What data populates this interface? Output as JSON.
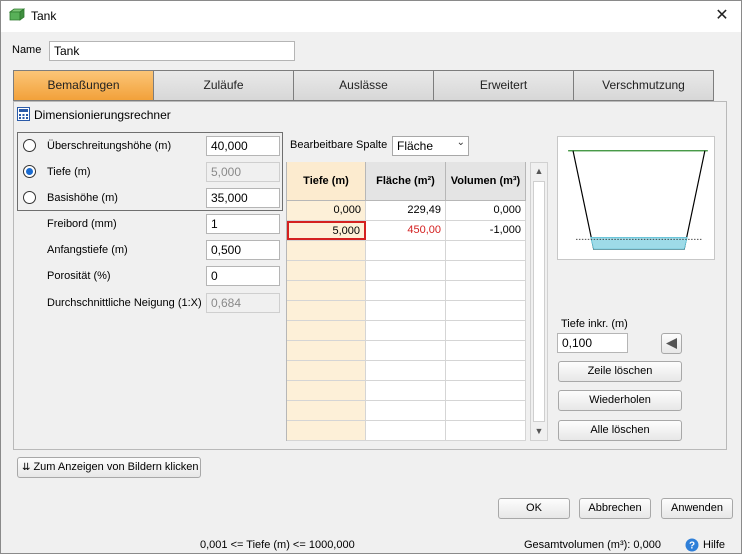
{
  "window": {
    "title": "Tank",
    "close_symbol": "✕"
  },
  "name_field": {
    "label": "Name",
    "value": "Tank"
  },
  "tabs": [
    {
      "label": "Bemaßungen",
      "active": true
    },
    {
      "label": "Zuläufe",
      "active": false
    },
    {
      "label": "Auslässe",
      "active": false
    },
    {
      "label": "Erweitert",
      "active": false
    },
    {
      "label": "Verschmutzung",
      "active": false
    }
  ],
  "calculator": {
    "label": "Dimensionierungsrechner"
  },
  "radio_group": [
    {
      "label": "Überschreitungshöhe (m)",
      "value": "40,000",
      "selected": false,
      "disabled": false
    },
    {
      "label": "Tiefe (m)",
      "value": "5,000",
      "selected": true,
      "disabled": true
    },
    {
      "label": "Basishöhe (m)",
      "value": "35,000",
      "selected": false,
      "disabled": false
    }
  ],
  "fields": [
    {
      "label": "Freibord (mm)",
      "value": "1",
      "disabled": false
    },
    {
      "label": "Anfangstiefe (m)",
      "value": "0,500",
      "disabled": false
    },
    {
      "label": "Porosität (%)",
      "value": "0",
      "disabled": false
    },
    {
      "label": "Durchschnittliche Neigung (1:X)",
      "value": "0,684",
      "disabled": true
    }
  ],
  "editable_column": {
    "label": "Bearbeitbare Spalte",
    "value": "Fläche"
  },
  "grid": {
    "headers": [
      "Tiefe (m)",
      "Fläche (m²)",
      "Volumen (m³)"
    ],
    "rows": [
      [
        "0,000",
        "229,49",
        "0,000"
      ],
      [
        "5,000",
        "450,00",
        "-1,000"
      ],
      [
        "",
        "",
        ""
      ],
      [
        "",
        "",
        ""
      ],
      [
        "",
        "",
        ""
      ],
      [
        "",
        "",
        ""
      ],
      [
        "",
        "",
        ""
      ],
      [
        "",
        "",
        ""
      ],
      [
        "",
        "",
        ""
      ],
      [
        "",
        "",
        ""
      ],
      [
        "",
        "",
        ""
      ],
      [
        "",
        "",
        ""
      ]
    ]
  },
  "depth_increment": {
    "label": "Tiefe inkr. (m)",
    "value": "0,100"
  },
  "buttons": {
    "delete_row": "Zeile löschen",
    "repeat": "Wiederholen",
    "delete_all": "Alle löschen",
    "show_images": "Zum Anzeigen von Bildern klicken",
    "ok": "OK",
    "cancel": "Abbrechen",
    "apply": "Anwenden",
    "help": "Hilfe"
  },
  "status": {
    "range": "0,001 <= Tiefe (m) <= 1000,000",
    "total_volume": "Gesamtvolumen (m³): 0,000"
  },
  "colors": {
    "active_tab": "#f2a13a",
    "selection": "#d42020",
    "accent": "#1a6bd0",
    "water": "#5bc0d6"
  }
}
